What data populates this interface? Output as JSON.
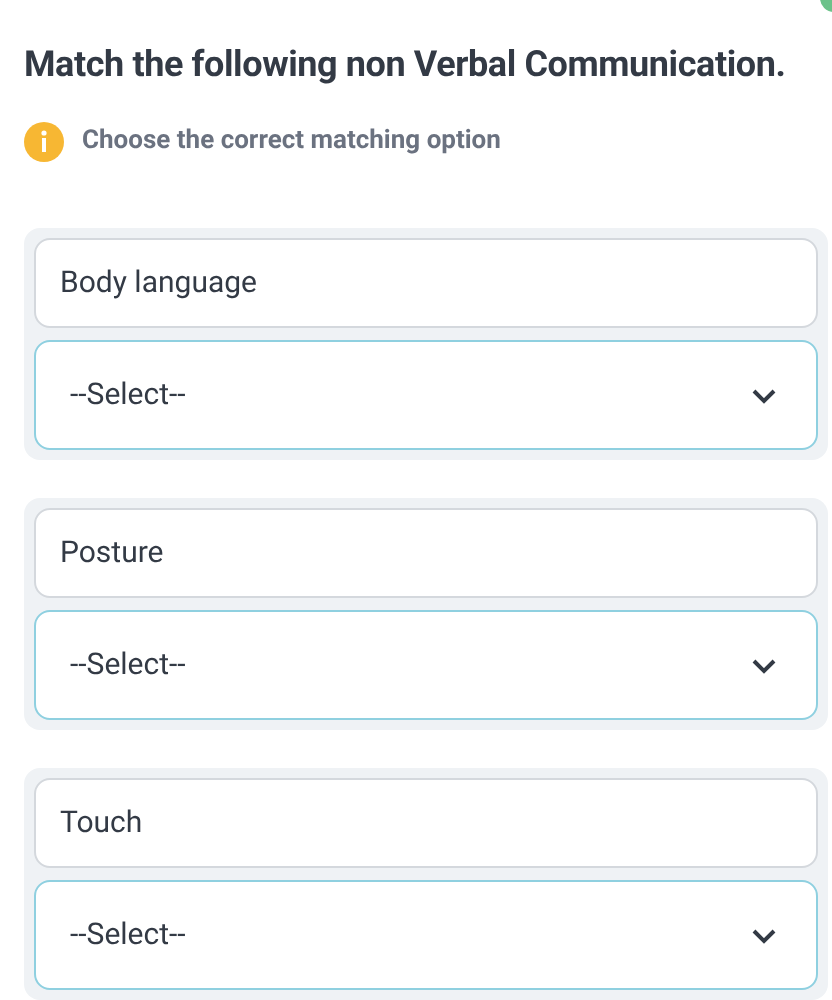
{
  "question": {
    "title": "Match the following non Verbal Communication.",
    "hint": "Choose the correct matching option"
  },
  "pairs": [
    {
      "prompt": "Body language",
      "select": {
        "value": "--Select--"
      }
    },
    {
      "prompt": "Posture",
      "select": {
        "value": "--Select--"
      }
    },
    {
      "prompt": "Touch",
      "select": {
        "value": "--Select--"
      }
    }
  ]
}
